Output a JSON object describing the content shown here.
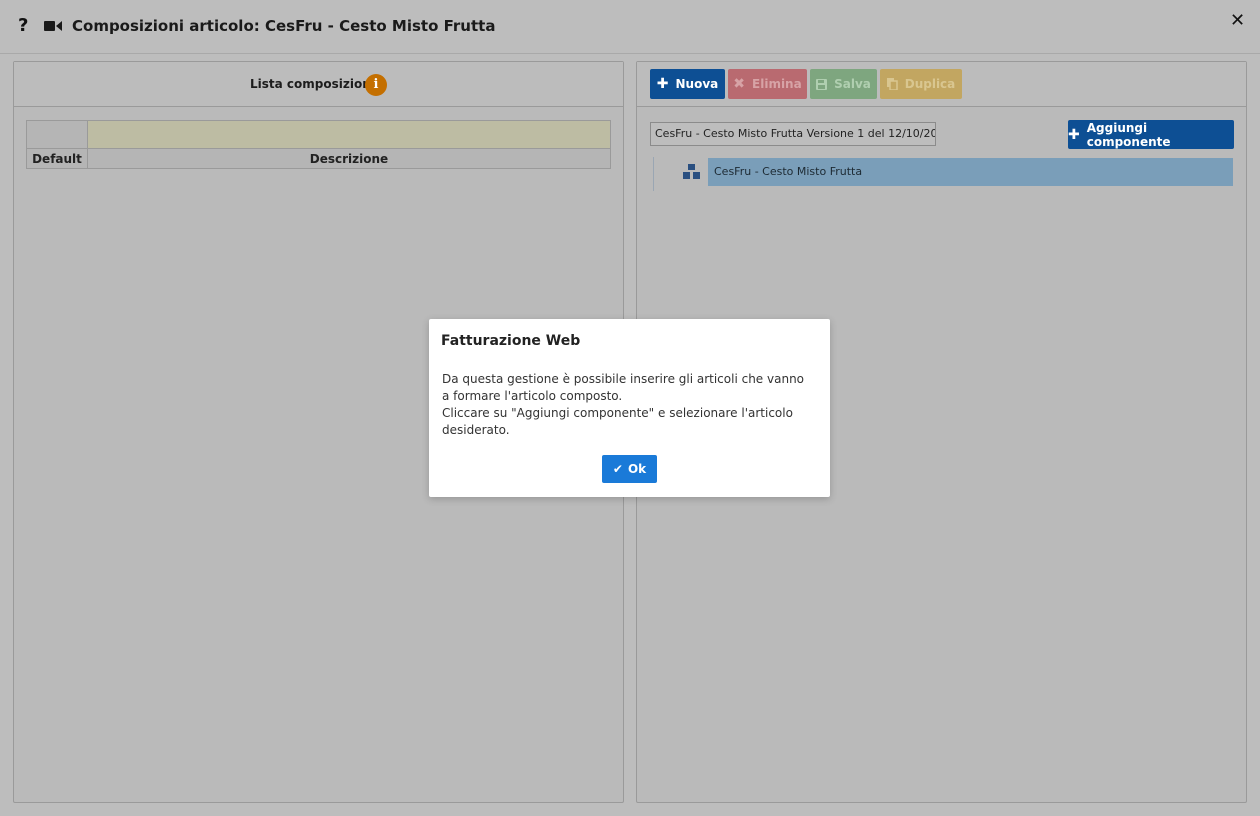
{
  "window": {
    "help_icon": "?",
    "title": "Composizioni articolo: CesFru - Cesto Misto Frutta",
    "close_icon": "✕"
  },
  "left_panel": {
    "title": "Lista composizioni",
    "info_icon": "i",
    "columns": [
      "Default",
      "Descrizione"
    ]
  },
  "right_panel": {
    "toolbar": {
      "nuova": "Nuova",
      "elimina": "Elimina",
      "salva": "Salva",
      "duplica": "Duplica"
    },
    "version_select": "CesFru - Cesto Misto Frutta Versione 1 del 12/10/20...",
    "add_component": "Aggiungi componente",
    "tree": [
      {
        "label": "CesFru - Cesto Misto Frutta",
        "icon": "boxes-icon"
      }
    ]
  },
  "dialog": {
    "title": "Fatturazione Web",
    "line1": "Da questa gestione è possibile inserire gli articoli che vanno a formare l'articolo composto.",
    "line2": "Cliccare su \"Aggiungi componente\" e selezionare l'articolo desiderato.",
    "ok": "Ok"
  },
  "colors": {
    "primary": "#0d4f94",
    "danger": "#b96a70",
    "success": "#7ea67f",
    "warning": "#c2a661",
    "info": "#c46f00",
    "ok": "#1a7ad8"
  }
}
